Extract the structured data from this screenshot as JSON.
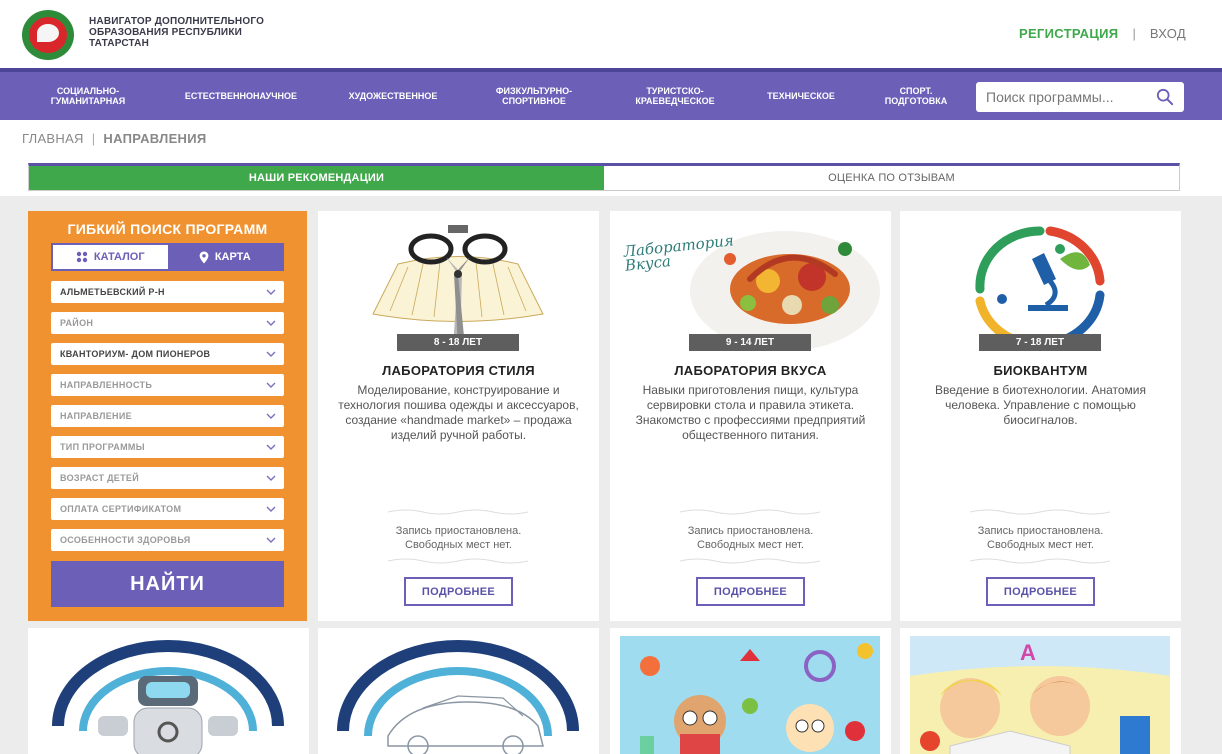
{
  "header": {
    "site_name_lines": [
      "НАВИГАТОР ДОПОЛНИТЕЛЬНОГО",
      "ОБРАЗОВАНИЯ РЕСПУБЛИКИ",
      "ТАТАРСТАН"
    ],
    "register": "РЕГИСТРАЦИЯ",
    "separator": "|",
    "login": "ВХОД"
  },
  "nav": {
    "items": [
      {
        "label": "СОЦИАЛЬНО-\nГУМАНИТАРНАЯ"
      },
      {
        "label": "ЕСТЕСТВЕННОНАУЧНОЕ"
      },
      {
        "label": "ХУДОЖЕСТВЕННОЕ"
      },
      {
        "label": "ФИЗКУЛЬТУРНО-\nСПОРТИВНОЕ"
      },
      {
        "label": "ТУРИСТСКО-\nКРАЕВЕДЧЕСКОЕ"
      },
      {
        "label": "ТЕХНИЧЕСКОЕ"
      },
      {
        "label": "СПОРТ.\nПОДГОТОВКА"
      }
    ],
    "search_placeholder": "Поиск программы..."
  },
  "breadcrumb": {
    "home": "ГЛАВНАЯ",
    "separator": "|",
    "current": "НАПРАВЛЕНИЯ"
  },
  "tabs": {
    "recommendations": "НАШИ РЕКОМЕНДАЦИИ",
    "by_reviews": "ОЦЕНКА ПО ОТЗЫВАМ"
  },
  "filter": {
    "title": "ГИБКИЙ ПОИСК ПРОГРАММ",
    "catalog": "КАТАЛОГ",
    "map": "КАРТА",
    "selects": [
      {
        "label": "АЛЬМЕТЬЕВСКИЙ Р-Н",
        "filled": true
      },
      {
        "label": "РАЙОН",
        "filled": false
      },
      {
        "label": "КВАНТОРИУМ- ДОМ ПИОНЕРОВ",
        "filled": true
      },
      {
        "label": "НАПРАВЛЕННОСТЬ",
        "filled": false
      },
      {
        "label": "НАПРАВЛЕНИЕ",
        "filled": false
      },
      {
        "label": "ТИП ПРОГРАММЫ",
        "filled": false
      },
      {
        "label": "ВОЗРАСТ ДЕТЕЙ",
        "filled": false
      },
      {
        "label": "ОПЛАТА СЕРТИФИКАТОМ",
        "filled": false
      },
      {
        "label": "ОСОБЕННОСТИ ЗДОРОВЬЯ",
        "filled": false
      }
    ],
    "find_button": "НАЙТИ"
  },
  "cards": [
    {
      "age": "8 - 18 ЛЕТ",
      "title": "ЛАБОРАТОРИЯ СТИЛЯ",
      "description": "Моделирование, конструирование и технология пошива одежды и аксессуаров, создание «handmade market» – продажа изделий ручной работы.",
      "status": "Запись приостановлена.\nСвободных мест нет.",
      "more": "ПОДРОБНЕЕ"
    },
    {
      "age": "9 - 14 ЛЕТ",
      "title": "ЛАБОРАТОРИЯ ВКУСА",
      "image_text": "Лаборатория\nВкуса",
      "description": "Навыки приготовления пищи, культура сервировки стола и правила этикета. Знакомство с профессиями предприятий общественного питания.",
      "status": "Запись приостановлена.\nСвободных мест нет.",
      "more": "ПОДРОБНЕЕ"
    },
    {
      "age": "7 - 18 ЛЕТ",
      "title": "БИОКВАНТУМ",
      "description": "Введение в биотехнологии. Анатомия человека. Управление с помощью биосигналов.",
      "status": "Запись приостановлена.\nСвободных мест нет.",
      "more": "ПОДРОБНЕЕ"
    }
  ],
  "colors": {
    "nav_purple": "#6b5fb8",
    "green": "#3ea84a",
    "orange": "#f0922f",
    "grey_bg": "#ececec"
  },
  "icons": {
    "catalog": "grid-icon",
    "map": "map-pin-icon",
    "search": "search-icon",
    "chevron": "chevron-down-icon"
  }
}
